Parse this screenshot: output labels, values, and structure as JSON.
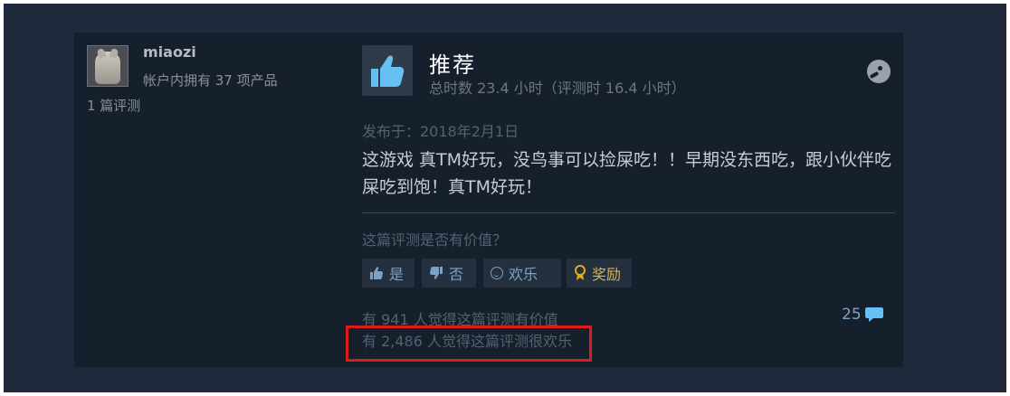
{
  "author": {
    "username": "miaozi",
    "products_owned": "帐户内拥有 37 项产品",
    "review_count": "1 篇评测"
  },
  "review": {
    "verdict": "推荐",
    "hours": "总时数 23.4 小时（评测时 16.4 小时）",
    "posted": "发布于：2018年2月1日",
    "text": "这游戏 真TM好玩，没鸟事可以捡屎吃！！早期没东西吃，跟小伙伴吃屎吃到饱！真TM好玩！"
  },
  "feedback": {
    "question": "这篇评测是否有价值？",
    "yes_label": "是",
    "no_label": "否",
    "funny_label": "欢乐",
    "award_label": "奖励"
  },
  "stats": {
    "helpful": "有 941 人觉得这篇评测有价值",
    "funny": "有 2,486 人觉得这篇评测很欢乐",
    "comment_count": "25"
  },
  "icons": {
    "verdict": "thumbs-up-icon",
    "platform": "steam-icon",
    "comments": "speech-bubble-icon",
    "award": "award-ribbon-icon"
  },
  "colors": {
    "background": "#1e2a3b",
    "panel": "#16202d",
    "accent": "#7ca2c8",
    "highlight": "#e0191c"
  }
}
